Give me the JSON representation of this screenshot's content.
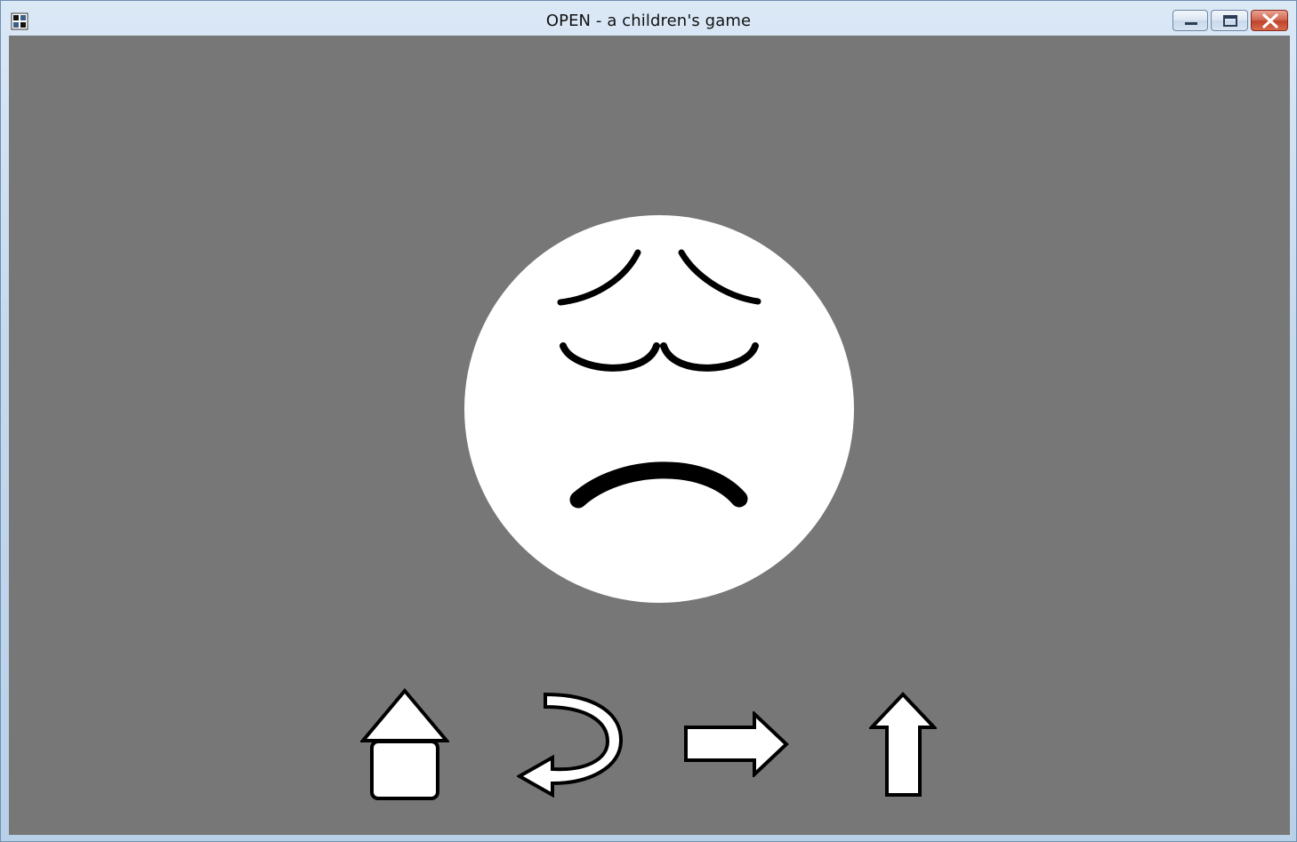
{
  "window": {
    "title": "OPEN - a children's game",
    "controls": [
      "minimize",
      "maximize",
      "close"
    ]
  },
  "game": {
    "background_color": "#777777",
    "face": {
      "expression": "sad",
      "fill_color": "#ffffff",
      "feature_color": "#000000"
    },
    "nav_buttons": [
      {
        "name": "home",
        "icon": "home-icon"
      },
      {
        "name": "back",
        "icon": "curved-back-arrow-icon"
      },
      {
        "name": "next",
        "icon": "right-arrow-icon"
      },
      {
        "name": "up",
        "icon": "up-arrow-icon"
      }
    ]
  }
}
